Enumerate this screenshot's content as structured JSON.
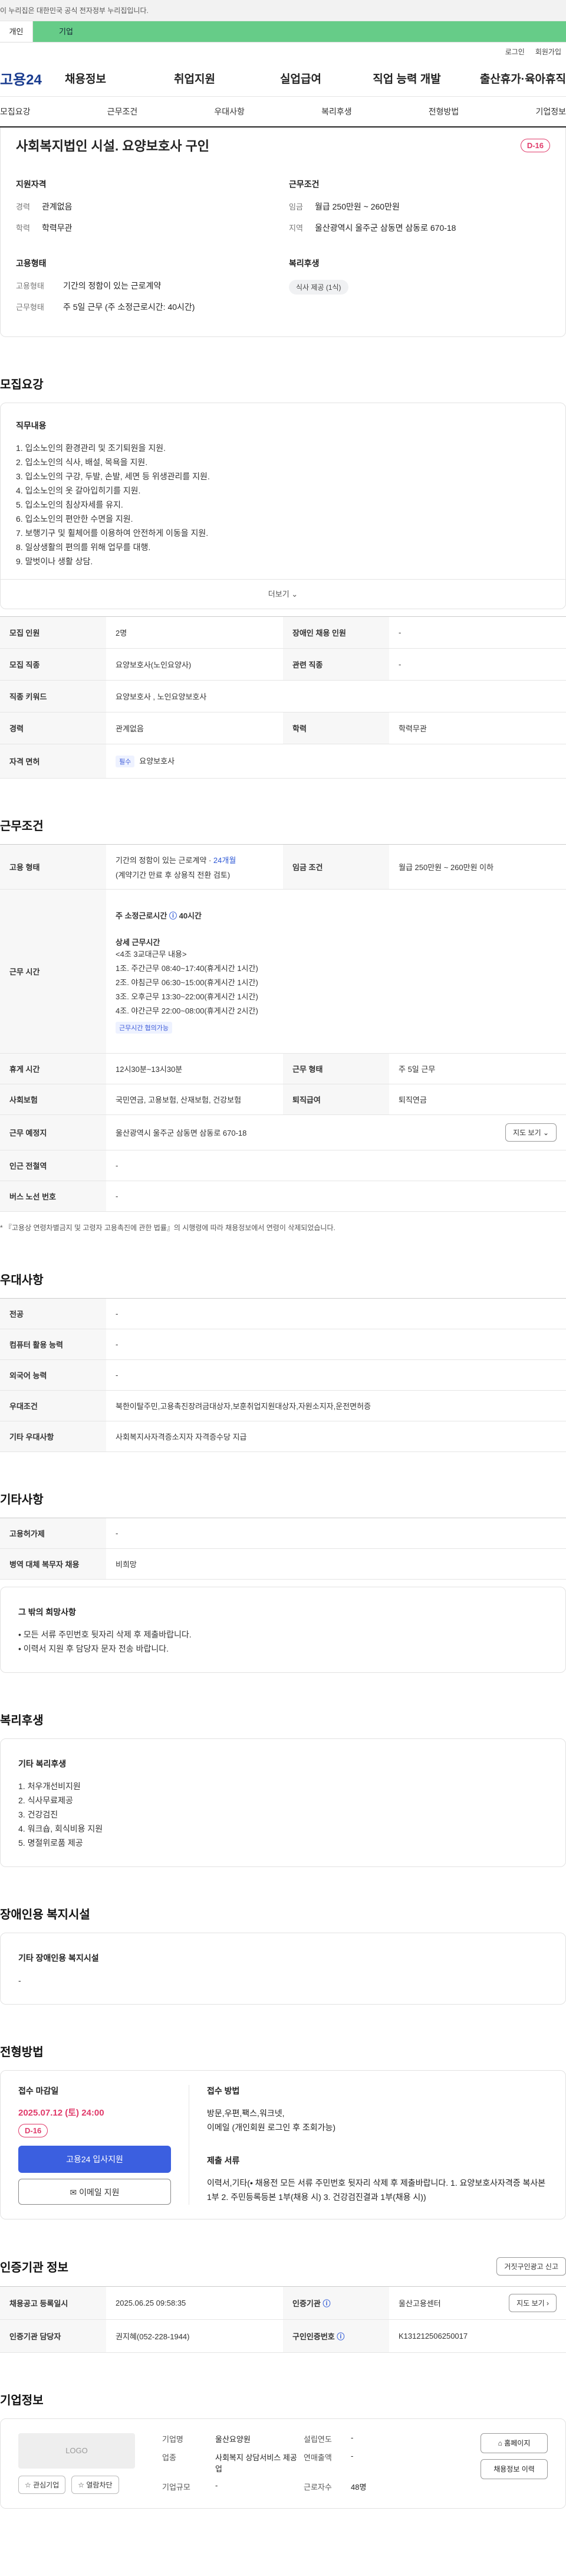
{
  "gov_banner": "이 누리집은 대한민국 공식 전자정부 누리집입니다.",
  "topbar": {
    "tab_individual": "개인",
    "tab_company": "기업"
  },
  "util": {
    "login": "로그인",
    "signup": "회원가입"
  },
  "gnb": {
    "logo": "고용24",
    "menus": [
      "채용정보",
      "취업지원",
      "실업급여",
      "직업 능력 개발",
      "출산휴가·육아휴직"
    ]
  },
  "anchor": [
    "모집요강",
    "근무조건",
    "우대사항",
    "복리후생",
    "전형방법",
    "기업정보"
  ],
  "summary": {
    "title": "사회복지법인 시설. 요양보호사 구인",
    "dday": "D-16",
    "qual": {
      "title": "지원자격",
      "career_k": "경력",
      "career_v": "관계없음",
      "edu_k": "학력",
      "edu_v": "학력무관"
    },
    "work": {
      "title": "근무조건",
      "wage_k": "임금",
      "wage_v": "월급 250만원 ~ 260만원",
      "loc_k": "지역",
      "loc_v": "울산광역시 울주군 삼동면 삼동로 670-18"
    },
    "emp": {
      "title": "고용형태",
      "type_k": "고용형태",
      "type_v": "기간의 정함이 있는 근로계약",
      "hours_k": "근무형태",
      "hours_v": "주 5일 근무 (주 소정근로시간: 40시간)"
    },
    "welfare": {
      "title": "복리후생",
      "chip": "식사 제공 (1식)"
    }
  },
  "recruit": {
    "title": "모집요강",
    "duty_title": "직무내용",
    "duties": [
      "1. 입소노인의 환경관리 및 조기퇴원을 지원.",
      "2. 입소노인의 식사, 배설, 목욕을 지원.",
      "3. 입소노인의 구강, 두발, 손발, 세면 등 위생관리를 지원.",
      "4. 입소노인의 옷 갈아입히기를 지원.",
      "5. 입소노인의 침상자세를 유지.",
      "6. 입소노인의 편안한 수면을 지원.",
      "7. 보행기구 및 휠체어를 이용하여 안전하게 이동을 지원.",
      "8. 일상생활의 편의를 위해 업무를 대행.",
      "9. 말벗이나 생활 상담."
    ],
    "more": "더보기 ⌄",
    "rows": {
      "count_k": "모집 인원",
      "count_v": "2명",
      "disabled_k": "장애인 채용 인원",
      "disabled_v": "-",
      "job_k": "모집 직종",
      "job_v": "요양보호사(노인요양사)",
      "related_k": "관련 직종",
      "related_v": "-",
      "keyword_k": "직종 키워드",
      "keyword_v": "요양보호사 , 노인요양보호사",
      "career_k": "경력",
      "career_v": "관계없음",
      "edu_k": "학력",
      "edu_v": "학력무관",
      "license_k": "자격 면허",
      "license_tag": "필수",
      "license_v": "요양보호사"
    }
  },
  "workcond": {
    "title": "근무조건",
    "emp_k": "고용 형태",
    "emp_v1": "기간의 정함이 있는 근로계약 · ",
    "emp_v1b": "24개월",
    "emp_v2": "(계약기간 만료 후 상용직 전환 검토)",
    "wage_k": "임금 조건",
    "wage_v": "월급 250만원 ~ 260만원 이하",
    "time_k": "근무 시간",
    "time_main": "주 소정근로시간 ",
    "time_main_b": "40시간",
    "time_detail_title": "상세 근무시간",
    "time_lines": [
      "<4조 3교대근무 내용>",
      "1조. 주간근무 08:40~17:40(휴게시간 1시간)",
      "2조. 야침근무 06:30~15:00(휴게시간 1시간)",
      "3조. 오후근무 13:30~22:00(휴게시간 1시간)",
      "4조. 야간근무 22:00~08:00(휴게시간 2시간)"
    ],
    "time_tag": "근무시간 협의가능",
    "rest_k": "휴게 시간",
    "rest_v": "12시30분~13시30분",
    "form_k": "근무 형태",
    "form_v": "주 5일 근무",
    "ins_k": "사회보험",
    "ins_v": "국민연금, 고용보험, 산재보험, 건강보험",
    "sev_k": "퇴직급여",
    "sev_v": "퇴직연금",
    "place_k": "근무 예정지",
    "place_v": "울산광역시 울주군 삼동면 삼동로 670-18",
    "map_btn": "지도 보기 ⌄",
    "subway_k": "인근 전철역",
    "subway_v": "-",
    "bus_k": "버스 노선 번호",
    "bus_v": "-",
    "note": "* 『고용상 연령차별금지 및 고령자 고용촉진에 관한 법률』의 시행령에 따라 채용정보에서 연령이 삭제되었습니다."
  },
  "pref": {
    "title": "우대사항",
    "major_k": "전공",
    "major_v": "-",
    "pc_k": "컴퓨터 활용 능력",
    "pc_v": "-",
    "lang_k": "외국어 능력",
    "lang_v": "-",
    "cond_k": "우대조건",
    "cond_v": "북한이탈주민,고용촉진장려금대상자,보훈취업지원대상자,자원소지자,운전면허증",
    "etc_k": "기타 우대사항",
    "etc_v": "사회복지사자격증소지자 자격증수당 지급"
  },
  "etc": {
    "title": "기타사항",
    "emp_k": "고용허가제",
    "emp_v": "-",
    "mil_k": "병역 대체 복무자 채용",
    "mil_v": "비희망",
    "hope_title": "그 밖의 희망사항",
    "hope_lines": [
      "• 모든 서류 주민번호 뒷자리 삭제 후 제출바랍니다.",
      "• 이력서 지원 후 담당자 문자 전송 바랍니다."
    ]
  },
  "welfare": {
    "title": "복리후생",
    "sub": "기타 복리후생",
    "items": [
      "1. 처우개선비지원",
      "2. 식사무료제공",
      "3. 건강검진",
      "4. 워크숍, 회식비용 지원",
      "5. 명절위로품 제공"
    ]
  },
  "disab": {
    "title": "장애인용 복지시설",
    "sub": "기타 장애인용 복지시설",
    "value": "-"
  },
  "process": {
    "title": "전형방법",
    "deadline_label": "접수 마감일",
    "deadline": "2025.07.12 (토) 24:00",
    "dday": "D-16",
    "apply_btn": "고용24 입사지원",
    "email_btn": "이메일 지원",
    "method_label": "접수 방법",
    "method_lines": [
      "방문,우편,팩스,워크넷,",
      "이메일 (개인회원 로그인 후 조회가능)"
    ],
    "docs_label": "제출 서류",
    "docs_text": "이력서,기타(• 채용전 모든 서류 주민번호 뒷자리 삭제 후 제출바랍니다. 1. 요양보호사자격증 복사본 1부 2. 주민등록등본 1부(채용 시) 3. 건강검진결과 1부(채용 시))"
  },
  "agency": {
    "title": "인증기관 정보",
    "report_btn": "거짓구인광고 신고",
    "reg_k": "채용공고 등록일시",
    "reg_v": "2025.06.25 09:58:35",
    "org_k": "인증기관",
    "org_v": "울산고용센터",
    "map_btn": "지도 보기 ›",
    "mgr_k": "인증기관 담당자",
    "mgr_v": "권지혜(052-228-1944)",
    "no_k": "구인인증번호",
    "no_v": "K131212506250017"
  },
  "corp": {
    "title": "기업정보",
    "logo": "LOGO",
    "fav_btn": "☆ 관심기업",
    "alarm_btn": "☆ 열람차단",
    "rows": [
      [
        "기업명",
        "울산요양원"
      ],
      [
        "업종",
        "사회복지 상담서비스 제공업"
      ],
      [
        "기업규모",
        "-"
      ]
    ],
    "rows2": [
      [
        "설립연도",
        "-"
      ],
      [
        "연매출액",
        "-"
      ],
      [
        "근로자수",
        "48명"
      ]
    ],
    "home_btn": "홈페이지",
    "jobs_btn": "채용정보 이력"
  }
}
